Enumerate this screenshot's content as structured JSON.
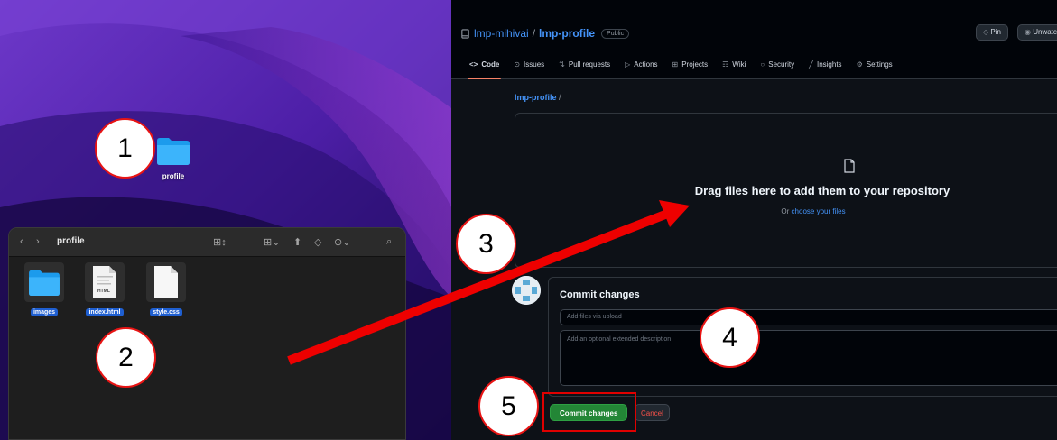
{
  "desktop": {
    "folder_label": "profile"
  },
  "finder": {
    "title": "profile",
    "files": [
      {
        "label": "images",
        "icon": "folder-icon"
      },
      {
        "label": "index.html",
        "icon": "html-file-icon",
        "badge": "HTML"
      },
      {
        "label": "style.css",
        "icon": "css-file-icon"
      }
    ]
  },
  "github": {
    "owner": "lmp-mihivai",
    "separator": "/",
    "repo": "lmp-profile",
    "visibility": "Public",
    "pin_label": "Pin",
    "watch_label": "Unwatc",
    "tabs": [
      {
        "label": "Code",
        "icon": "code-icon"
      },
      {
        "label": "Issues",
        "icon": "issue-icon"
      },
      {
        "label": "Pull requests",
        "icon": "pull-request-icon"
      },
      {
        "label": "Actions",
        "icon": "play-icon"
      },
      {
        "label": "Projects",
        "icon": "table-icon"
      },
      {
        "label": "Wiki",
        "icon": "book-icon"
      },
      {
        "label": "Security",
        "icon": "shield-icon"
      },
      {
        "label": "Insights",
        "icon": "graph-icon"
      },
      {
        "label": "Settings",
        "icon": "gear-icon"
      }
    ],
    "breadcrumb_repo": "lmp-profile",
    "breadcrumb_sep": "/",
    "drop_title": "Drag files here to add them to your repository",
    "drop_sub_prefix": "Or",
    "drop_sub_link": "choose your files",
    "commit": {
      "title": "Commit changes",
      "summary_placeholder": "Add files via upload",
      "description_placeholder": "Add an optional extended description",
      "commit_button": "Commit changes",
      "cancel_button": "Cancel"
    }
  },
  "annotations": [
    "1",
    "2",
    "3",
    "4",
    "5"
  ],
  "colors": {
    "accent_red": "#e81414",
    "github_blue": "#4493f8",
    "commit_green": "#238636"
  }
}
